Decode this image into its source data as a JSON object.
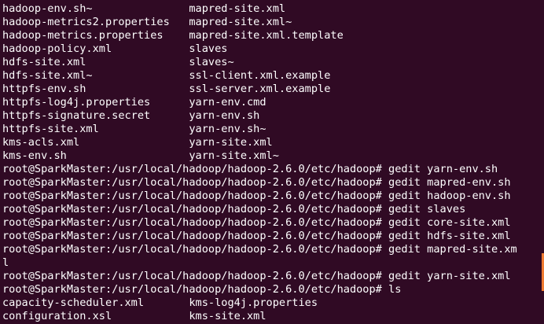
{
  "terminal": {
    "background_color": "#300a24",
    "text_color": "#ffffff",
    "scrollbar_color": "#ef7b32",
    "lines": [
      "hadoop-env.sh~               mapred-site.xml",
      "hadoop-metrics2.properties   mapred-site.xml~",
      "hadoop-metrics.properties    mapred-site.xml.template",
      "hadoop-policy.xml            slaves",
      "hdfs-site.xml                slaves~",
      "hdfs-site.xml~               ssl-client.xml.example",
      "httpfs-env.sh                ssl-server.xml.example",
      "httpfs-log4j.properties      yarn-env.cmd",
      "httpfs-signature.secret      yarn-env.sh",
      "httpfs-site.xml              yarn-env.sh~",
      "kms-acls.xml                 yarn-site.xml",
      "kms-env.sh                   yarn-site.xml~",
      "root@SparkMaster:/usr/local/hadoop/hadoop-2.6.0/etc/hadoop# gedit yarn-env.sh",
      "root@SparkMaster:/usr/local/hadoop/hadoop-2.6.0/etc/hadoop# gedit mapred-env.sh",
      "root@SparkMaster:/usr/local/hadoop/hadoop-2.6.0/etc/hadoop# gedit hadoop-env.sh",
      "root@SparkMaster:/usr/local/hadoop/hadoop-2.6.0/etc/hadoop# gedit slaves",
      "root@SparkMaster:/usr/local/hadoop/hadoop-2.6.0/etc/hadoop# gedit core-site.xml",
      "root@SparkMaster:/usr/local/hadoop/hadoop-2.6.0/etc/hadoop# gedit hdfs-site.xml",
      "root@SparkMaster:/usr/local/hadoop/hadoop-2.6.0/etc/hadoop# gedit mapred-site.xm",
      "l",
      "root@SparkMaster:/usr/local/hadoop/hadoop-2.6.0/etc/hadoop# gedit yarn-site.xml",
      "root@SparkMaster:/usr/local/hadoop/hadoop-2.6.0/etc/hadoop# ls",
      "capacity-scheduler.xml       kms-log4j.properties",
      "configuration.xsl            kms-site.xml"
    ]
  }
}
